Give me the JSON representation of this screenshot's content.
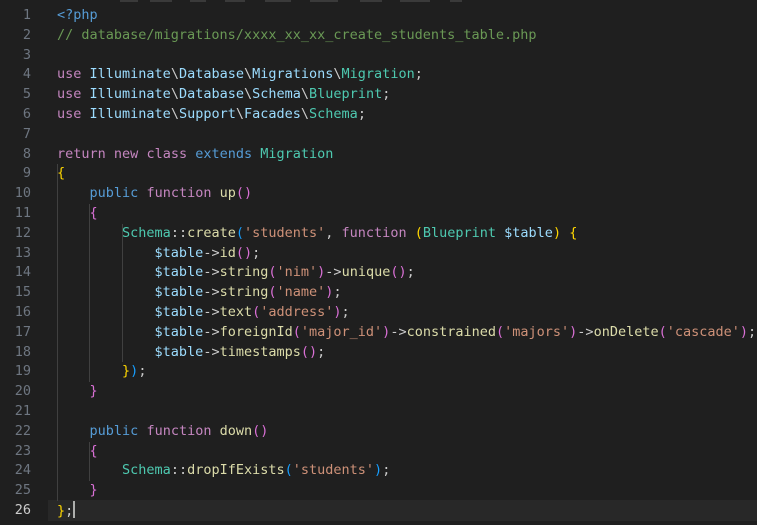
{
  "editor": {
    "active_line": 26,
    "line_numbers": [
      "1",
      "2",
      "3",
      "4",
      "5",
      "6",
      "7",
      "8",
      "9",
      "10",
      "11",
      "12",
      "13",
      "14",
      "15",
      "16",
      "17",
      "18",
      "19",
      "20",
      "21",
      "22",
      "23",
      "24",
      "25",
      "26"
    ],
    "lines": [
      [
        {
          "t": "<?php",
          "c": "php"
        }
      ],
      [
        {
          "t": "// database/migrations/xxxx_xx_xx_create_students_table.php",
          "c": "cm"
        }
      ],
      [],
      [
        {
          "t": "use",
          "c": "kw-ctrl"
        },
        {
          "t": " ",
          "c": "pun"
        },
        {
          "t": "Illuminate",
          "c": "ns"
        },
        {
          "t": "\\",
          "c": "pun"
        },
        {
          "t": "Database",
          "c": "ns"
        },
        {
          "t": "\\",
          "c": "pun"
        },
        {
          "t": "Migrations",
          "c": "ns"
        },
        {
          "t": "\\",
          "c": "pun"
        },
        {
          "t": "Migration",
          "c": "cls"
        },
        {
          "t": ";",
          "c": "pun"
        }
      ],
      [
        {
          "t": "use",
          "c": "kw-ctrl"
        },
        {
          "t": " ",
          "c": "pun"
        },
        {
          "t": "Illuminate",
          "c": "ns"
        },
        {
          "t": "\\",
          "c": "pun"
        },
        {
          "t": "Database",
          "c": "ns"
        },
        {
          "t": "\\",
          "c": "pun"
        },
        {
          "t": "Schema",
          "c": "ns"
        },
        {
          "t": "\\",
          "c": "pun"
        },
        {
          "t": "Blueprint",
          "c": "cls"
        },
        {
          "t": ";",
          "c": "pun"
        }
      ],
      [
        {
          "t": "use",
          "c": "kw-ctrl"
        },
        {
          "t": " ",
          "c": "pun"
        },
        {
          "t": "Illuminate",
          "c": "ns"
        },
        {
          "t": "\\",
          "c": "pun"
        },
        {
          "t": "Support",
          "c": "ns"
        },
        {
          "t": "\\",
          "c": "pun"
        },
        {
          "t": "Facades",
          "c": "ns"
        },
        {
          "t": "\\",
          "c": "pun"
        },
        {
          "t": "Schema",
          "c": "cls"
        },
        {
          "t": ";",
          "c": "pun"
        }
      ],
      [],
      [
        {
          "t": "return",
          "c": "kw-ctrl"
        },
        {
          "t": " ",
          "c": "pun"
        },
        {
          "t": "new",
          "c": "kw-ctrl"
        },
        {
          "t": " ",
          "c": "pun"
        },
        {
          "t": "class",
          "c": "kw-ctrl"
        },
        {
          "t": " ",
          "c": "pun"
        },
        {
          "t": "extends",
          "c": "kw"
        },
        {
          "t": " ",
          "c": "pun"
        },
        {
          "t": "Migration",
          "c": "cls"
        }
      ],
      [
        {
          "t": "{",
          "c": "b1"
        }
      ],
      [
        {
          "t": "    ",
          "c": "pun"
        },
        {
          "t": "public",
          "c": "kw"
        },
        {
          "t": " ",
          "c": "pun"
        },
        {
          "t": "function",
          "c": "kw-ctrl"
        },
        {
          "t": " ",
          "c": "pun"
        },
        {
          "t": "up",
          "c": "fn"
        },
        {
          "t": "()",
          "c": "b2"
        }
      ],
      [
        {
          "t": "    ",
          "c": "pun"
        },
        {
          "t": "{",
          "c": "b2"
        }
      ],
      [
        {
          "t": "        ",
          "c": "pun"
        },
        {
          "t": "Schema",
          "c": "cls"
        },
        {
          "t": "::",
          "c": "pun"
        },
        {
          "t": "create",
          "c": "fn"
        },
        {
          "t": "(",
          "c": "b3"
        },
        {
          "t": "'students'",
          "c": "str"
        },
        {
          "t": ", ",
          "c": "pun"
        },
        {
          "t": "function",
          "c": "kw-ctrl"
        },
        {
          "t": " ",
          "c": "pun"
        },
        {
          "t": "(",
          "c": "b1"
        },
        {
          "t": "Blueprint",
          "c": "cls"
        },
        {
          "t": " ",
          "c": "pun"
        },
        {
          "t": "$table",
          "c": "var"
        },
        {
          "t": ")",
          "c": "b1"
        },
        {
          "t": " ",
          "c": "pun"
        },
        {
          "t": "{",
          "c": "b1"
        }
      ],
      [
        {
          "t": "            ",
          "c": "pun"
        },
        {
          "t": "$table",
          "c": "var"
        },
        {
          "t": "->",
          "c": "pun"
        },
        {
          "t": "id",
          "c": "fn"
        },
        {
          "t": "()",
          "c": "b2"
        },
        {
          "t": ";",
          "c": "pun"
        }
      ],
      [
        {
          "t": "            ",
          "c": "pun"
        },
        {
          "t": "$table",
          "c": "var"
        },
        {
          "t": "->",
          "c": "pun"
        },
        {
          "t": "string",
          "c": "fn"
        },
        {
          "t": "(",
          "c": "b2"
        },
        {
          "t": "'nim'",
          "c": "str"
        },
        {
          "t": ")",
          "c": "b2"
        },
        {
          "t": "->",
          "c": "pun"
        },
        {
          "t": "unique",
          "c": "fn"
        },
        {
          "t": "()",
          "c": "b2"
        },
        {
          "t": ";",
          "c": "pun"
        }
      ],
      [
        {
          "t": "            ",
          "c": "pun"
        },
        {
          "t": "$table",
          "c": "var"
        },
        {
          "t": "->",
          "c": "pun"
        },
        {
          "t": "string",
          "c": "fn"
        },
        {
          "t": "(",
          "c": "b2"
        },
        {
          "t": "'name'",
          "c": "str"
        },
        {
          "t": ")",
          "c": "b2"
        },
        {
          "t": ";",
          "c": "pun"
        }
      ],
      [
        {
          "t": "            ",
          "c": "pun"
        },
        {
          "t": "$table",
          "c": "var"
        },
        {
          "t": "->",
          "c": "pun"
        },
        {
          "t": "text",
          "c": "fn"
        },
        {
          "t": "(",
          "c": "b2"
        },
        {
          "t": "'address'",
          "c": "str"
        },
        {
          "t": ")",
          "c": "b2"
        },
        {
          "t": ";",
          "c": "pun"
        }
      ],
      [
        {
          "t": "            ",
          "c": "pun"
        },
        {
          "t": "$table",
          "c": "var"
        },
        {
          "t": "->",
          "c": "pun"
        },
        {
          "t": "foreignId",
          "c": "fn"
        },
        {
          "t": "(",
          "c": "b2"
        },
        {
          "t": "'major_id'",
          "c": "str"
        },
        {
          "t": ")",
          "c": "b2"
        },
        {
          "t": "->",
          "c": "pun"
        },
        {
          "t": "constrained",
          "c": "fn"
        },
        {
          "t": "(",
          "c": "b2"
        },
        {
          "t": "'majors'",
          "c": "str"
        },
        {
          "t": ")",
          "c": "b2"
        },
        {
          "t": "->",
          "c": "pun"
        },
        {
          "t": "onDelete",
          "c": "fn"
        },
        {
          "t": "(",
          "c": "b2"
        },
        {
          "t": "'cascade'",
          "c": "str"
        },
        {
          "t": ")",
          "c": "b2"
        },
        {
          "t": ";",
          "c": "pun"
        }
      ],
      [
        {
          "t": "            ",
          "c": "pun"
        },
        {
          "t": "$table",
          "c": "var"
        },
        {
          "t": "->",
          "c": "pun"
        },
        {
          "t": "timestamps",
          "c": "fn"
        },
        {
          "t": "()",
          "c": "b2"
        },
        {
          "t": ";",
          "c": "pun"
        }
      ],
      [
        {
          "t": "        ",
          "c": "pun"
        },
        {
          "t": "}",
          "c": "b1"
        },
        {
          "t": ")",
          "c": "b3"
        },
        {
          "t": ";",
          "c": "pun"
        }
      ],
      [
        {
          "t": "    ",
          "c": "pun"
        },
        {
          "t": "}",
          "c": "b2"
        }
      ],
      [],
      [
        {
          "t": "    ",
          "c": "pun"
        },
        {
          "t": "public",
          "c": "kw"
        },
        {
          "t": " ",
          "c": "pun"
        },
        {
          "t": "function",
          "c": "kw-ctrl"
        },
        {
          "t": " ",
          "c": "pun"
        },
        {
          "t": "down",
          "c": "fn"
        },
        {
          "t": "()",
          "c": "b2"
        }
      ],
      [
        {
          "t": "    ",
          "c": "pun"
        },
        {
          "t": "{",
          "c": "b2"
        }
      ],
      [
        {
          "t": "        ",
          "c": "pun"
        },
        {
          "t": "Schema",
          "c": "cls"
        },
        {
          "t": "::",
          "c": "pun"
        },
        {
          "t": "dropIfExists",
          "c": "fn"
        },
        {
          "t": "(",
          "c": "b3"
        },
        {
          "t": "'students'",
          "c": "str"
        },
        {
          "t": ")",
          "c": "b3"
        },
        {
          "t": ";",
          "c": "pun"
        }
      ],
      [
        {
          "t": "    ",
          "c": "pun"
        },
        {
          "t": "}",
          "c": "b2"
        }
      ],
      [
        {
          "t": "}",
          "c": "b1"
        },
        {
          "t": ";",
          "c": "pun"
        }
      ]
    ]
  }
}
